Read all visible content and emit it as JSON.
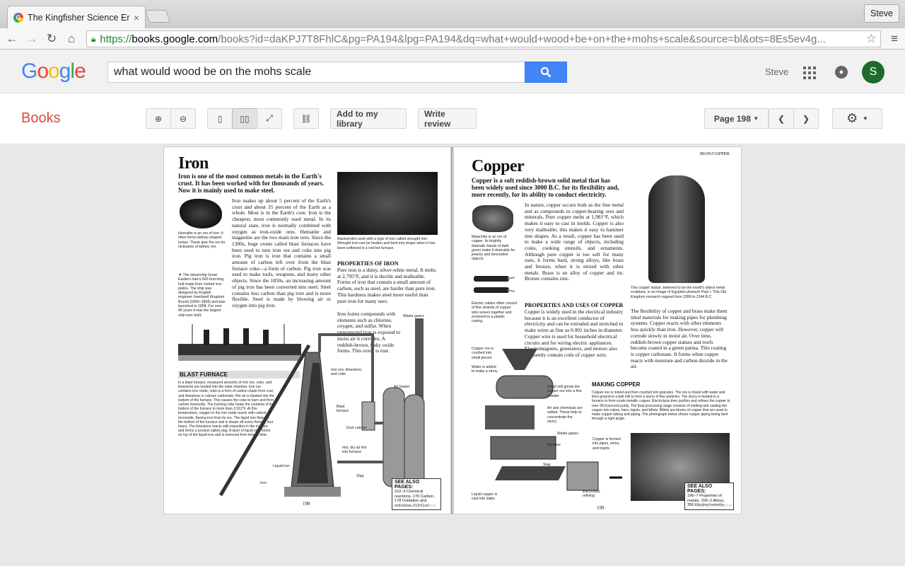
{
  "browser": {
    "tab_title": "The Kingfisher Science Enc",
    "tab_close": "×",
    "profile": "Steve",
    "url_scheme": "https://",
    "url_domain": "books.google.com",
    "url_path": "/books?id=daKPJ7T8FhlC&pg=PA194&lpg=PA194&dq=what+would+wood+be+on+the+mohs+scale&source=bl&ots=8Es5ev4g..."
  },
  "google": {
    "logo_letters": [
      "G",
      "o",
      "o",
      "g",
      "l",
      "e"
    ],
    "logo_colors": [
      "#4285f4",
      "#ea4335",
      "#fbbc05",
      "#4285f4",
      "#34a853",
      "#ea4335"
    ],
    "search_value": "what would wood be on the mohs scale",
    "user_name": "Steve",
    "avatar_letter": "S"
  },
  "books_bar": {
    "brand": "Books",
    "add_library": "Add to my library",
    "write_review": "Write review",
    "page_select": "Page 198"
  },
  "left_page": {
    "title": "Iron",
    "intro": "Iron is one of the most common metals in the Earth's crust. It has been worked with for thousands of years. Now it is mainly used to make steel.",
    "body1": "Iron makes up about 5 percent of the Earth's crust and about 35 percent of the Earth as a whole. Most is in the Earth's core. Iron is the cheapest, most commonly used metal. In its natural state, iron is normally combined with oxygen as iron-oxide ores. Hematite and magnetite are the two main iron ores. Since the 1300s, huge ovens called blast furnaces have been used to turn iron ore and coke into pig iron. Pig iron is iron that contains a small amount of carbon left over from the blast furnace coke—a form of carbon. Pig iron was used to make tools, weapons, and many other objects. Since the 1850s, an increasing amount of pig iron has been converted into steel. Steel contains less carbon than pig iron and is more flexible. Steel is made by blowing air or oxygen into pig iron.",
    "cap_hematite": "Hematite is an ore of iron. It often forms kidney-shaped lumps. These give the ore its nickname of kidney ore.",
    "cap_steamship": "▼ The steamship Great Eastern had a 692-foot-long hull made from riveted iron plates. The ship was designed by English engineer Isambard Kingdom Brunel (1806–1859) and was launched in 1858. For over 40 years it was the largest ship ever built.",
    "cap_blacksmith": "Blacksmiths work with a type of iron called wrought iron. Wrought iron can be beaten and bent into shape when it has been softened in a red-hot furnace.",
    "props_heading": "PROPERTIES OF IRON",
    "props_text": "Pure iron is a shiny, silver-white metal. It melts at 2,795°F, and it is ductile and malleable. Forms of iron that contain a small amount of carbon, such as steel, are harder than pure iron. This hardness makes steel more useful than pure iron for many uses.",
    "props_text2": "Iron forms compounds with elements such as chlorine, oxygen, and sulfur. When unprotected iron is exposed to moist air it corrodes. A reddish-brown, flaky oxide forms. This oxide is rust.",
    "blast_heading": "BLAST FURNACE",
    "blast_text": "In a blast furnace, measured amounts of iron ore, coke, and limestone are loaded into the main chamber. Iron ore contains iron oxide, coke is a form of carbon made from coal, and limestone is calcium carbonate. Hot air is blasted into the bottom of the furnace. This causes the coke to burn and form carbon monoxide. The burning coke heats the contents of the bottom of the furnace to more than 2,912°F. At this temperature, oxygen in the iron oxide reacts with carbon monoxide, freeing iron from its ore. The liquid iron flows to the bottom of the furnace and is drawn off every three or four hours. The limestone reacts with impurities in the iron ore and forms a product called slag. A layer of liquid slag forms on top of the liquid iron and is removed from time to time.",
    "labels": {
      "ore": "Iron ore, limestone, and coke",
      "waste": "Waste gases",
      "blast": "Blast furnace",
      "air": "Air heater",
      "dust": "Dust catcher",
      "hot": "Hot, dry air fed into furnace",
      "liquid": "Liquid iron",
      "slag": "Slag",
      "iron": "Iron"
    },
    "see_title": "SEE ALSO PAGES:",
    "see_text": "162–3 Chemical reactions, 170 Carbon, 178 Oxidation and reduction, 213 Coal",
    "page_number": "198",
    "watermark": "Copyrighted material"
  },
  "right_page": {
    "header": "IRON/COPPER",
    "title": "Copper",
    "intro": "Copper is a soft reddish-brown solid metal that has been widely used since 3000 B.C. for its flexibility and, more recently, for its ability to conduct electricity.",
    "body1": "In nature, copper occurs both as the free metal and as compounds in copper-bearing ores and minerals. Pure copper melts at 1,981°F, which makes it easy to cast in molds. Copper is also very malleable; this makes it easy to hammer into shapes. As a result, copper has been used to make a wide range of objects, including coins, cooking utensils, and ornaments. Although pure copper is too soft for many uses, it forms hard, strong alloys, like brass and bronze, when it is mixed with other metals. Brass is an alloy of copper and tin. Bronze contains zinc.",
    "cap_malachite": "Malachite is an ore of copper. Its brightly dramatic bands of dark green make it desirable for jewelry and decorative objects.",
    "cap_cables": "Electric cables often consist of fine strands of copper wire woven together and enclosed in a plastic casing.",
    "props_heading": "PROPERTIES AND USES OF COPPER",
    "props_text": "Copper is widely used in the electrical industry because it is an excellent conductor of electricity and can be extruded and stretched to make wires as fine as 0.001 inches in diameter. Copper wire is used for household electrical circuits and for wiring electric appliances. Electromagnets, generators, and motors also frequently contain coils of copper wire.",
    "cap_statue": "This copper statue, believed to be the world's oldest metal sculpture, is an image of Egyptian pharaoh Pepi I. This Old Kingdom monarch reigned from 2289 to 2244 B.C.",
    "body2": "The flexibility of copper and brass make them ideal materials for making pipes for plumbing systems. Copper reacts with other elements less quickly than iron. However, copper will corrode slowly in moist air. Over time, reddish-brown copper statues and roofs become coated in a green patina. This coating is copper carbonate. It forms when copper reacts with moisture and carbon dioxide in the air.",
    "making_heading": "MAKING COPPER",
    "making_text": "Copper ore is mined and then crushed into granules. The ore is mixed with water and then ground in a ball mill to form a slurry of fine particles. The slurry is heated in a furnace to form crude metallic copper. Electrolysis then purifies and refines the copper to over 99.8 percent purity. The final processing stage consists of melting and casting the copper into cakes, bars, ingots, and billets. Billets are blocks of copper that are used to make copper tubing and piping. The photograph below shows copper piping being bent through a right angle.",
    "labels": {
      "crushed": "Copper ore is crushed into small pieces",
      "water": "Water is added to make a slurry",
      "ballmill": "A ball mill grinds the copper ore into a fine powder",
      "airchem": "Air and chemicals are added. These help to concentrate the slurry.",
      "waste": "Waste gases",
      "furnace": "Furnace",
      "slag": "Slag",
      "formed": "Copper is formed into pipes, wires, and ingots",
      "liquid": "Liquid copper is cast into slabs",
      "electro": "Electrolytic refining"
    },
    "see_title": "SEE ALSO PAGES:",
    "see_text": "196–7 Properties of metals, 200–2 Alloys, 356 Electrochemistry",
    "page_number": "199",
    "watermark": "Copyrighted material"
  }
}
